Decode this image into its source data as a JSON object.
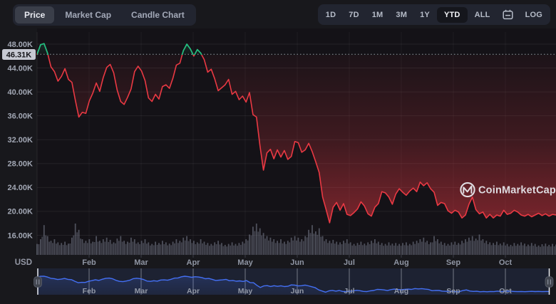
{
  "toolbar_left": {
    "tabs": [
      {
        "label": "Price",
        "selected": true
      },
      {
        "label": "Market Cap",
        "selected": false
      },
      {
        "label": "Candle Chart",
        "selected": false
      }
    ]
  },
  "toolbar_right": {
    "ranges": [
      "1D",
      "7D",
      "1M",
      "3M",
      "1Y",
      "YTD",
      "ALL"
    ],
    "selected_range": "YTD",
    "calendar_icon": "calendar-icon",
    "log_label": "LOG"
  },
  "axis": {
    "currency_label": "USD",
    "open_price_label": "46.31K",
    "y_ticks": [
      "48.00K",
      "44.00K",
      "40.00K",
      "36.00K",
      "32.00K",
      "28.00K",
      "24.00K",
      "20.00K",
      "16.00K"
    ]
  },
  "watermark": {
    "text": "CoinMarketCap",
    "logo": "coinmarketcap-logo"
  },
  "chart_data": {
    "type": "line",
    "title": "Bitcoin price, YTD, USD",
    "legend_position": "none",
    "grid": true,
    "x_months": [
      "Feb",
      "Mar",
      "Apr",
      "May",
      "Jun",
      "Jul",
      "Aug",
      "Sep",
      "Oct"
    ],
    "y_ticks_values": [
      48000,
      44000,
      40000,
      36000,
      32000,
      28000,
      24000,
      20000,
      16000
    ],
    "ylim": [
      16000,
      49500
    ],
    "open_price": 46310,
    "up_color": "#16c784",
    "down_color": "#ea3943",
    "navigator_color": "#4470f4",
    "volume_color": "#878da0",
    "prices_k": [
      46.3,
      47.9,
      48.1,
      46.5,
      44.2,
      43.4,
      41.8,
      42.6,
      43.9,
      42.1,
      41.6,
      38.6,
      35.8,
      36.6,
      36.4,
      38.5,
      39.8,
      41.5,
      40.1,
      42.4,
      44.1,
      44.6,
      43.2,
      40.3,
      38.4,
      37.9,
      39.1,
      40.5,
      43.4,
      44.3,
      43.5,
      41.9,
      39.0,
      38.4,
      39.6,
      38.8,
      40.9,
      41.2,
      40.6,
      42.3,
      44.5,
      44.8,
      46.9,
      48.0,
      47.2,
      46.0,
      47.1,
      46.5,
      45.4,
      43.3,
      43.8,
      42.2,
      40.2,
      40.7,
      41.2,
      42.1,
      39.6,
      40.1,
      38.7,
      39.3,
      38.3,
      39.9,
      36.2,
      35.8,
      31.0,
      26.9,
      29.8,
      30.4,
      28.8,
      30.3,
      29.1,
      30.2,
      28.7,
      29.2,
      31.7,
      31.5,
      29.9,
      30.3,
      31.4,
      30.0,
      28.3,
      26.5,
      22.4,
      20.3,
      18.1,
      20.7,
      21.5,
      20.2,
      21.3,
      19.5,
      19.3,
      19.8,
      20.4,
      21.6,
      20.9,
      19.6,
      19.2,
      20.7,
      21.3,
      23.3,
      23.1,
      22.4,
      21.2,
      22.9,
      23.8,
      23.2,
      22.7,
      23.4,
      23.9,
      23.3,
      24.9,
      24.3,
      24.8,
      23.8,
      23.2,
      21.0,
      21.5,
      21.3,
      20.1,
      19.7,
      20.2,
      19.9,
      18.9,
      19.4,
      21.2,
      22.4,
      20.3,
      19.6,
      19.9,
      18.9,
      19.5,
      18.9,
      19.4,
      19.2,
      20.2,
      19.5,
      19.7,
      20.2,
      19.9,
      19.4,
      19.2,
      19.5,
      19.1,
      19.4,
      19.7,
      19.3,
      19.6,
      19.2,
      19.5,
      19.4
    ],
    "volumes": [
      0.35,
      0.5,
      0.95,
      0.6,
      0.45,
      0.5,
      0.4,
      0.38,
      0.42,
      0.36,
      0.55,
      1.0,
      0.8,
      0.5,
      0.45,
      0.5,
      0.42,
      0.6,
      0.45,
      0.5,
      0.55,
      0.48,
      0.4,
      0.52,
      0.6,
      0.45,
      0.42,
      0.55,
      0.5,
      0.4,
      0.45,
      0.5,
      0.4,
      0.35,
      0.42,
      0.38,
      0.45,
      0.4,
      0.36,
      0.42,
      0.5,
      0.45,
      0.55,
      0.6,
      0.5,
      0.45,
      0.4,
      0.5,
      0.42,
      0.38,
      0.35,
      0.4,
      0.45,
      0.38,
      0.32,
      0.35,
      0.4,
      0.35,
      0.38,
      0.42,
      0.5,
      0.65,
      0.9,
      1.0,
      0.85,
      0.7,
      0.6,
      0.55,
      0.5,
      0.45,
      0.5,
      0.42,
      0.45,
      0.55,
      0.6,
      0.55,
      0.5,
      0.6,
      0.8,
      0.95,
      0.75,
      0.85,
      0.6,
      0.5,
      0.45,
      0.48,
      0.42,
      0.4,
      0.45,
      0.5,
      0.4,
      0.35,
      0.38,
      0.42,
      0.36,
      0.4,
      0.45,
      0.5,
      0.42,
      0.38,
      0.35,
      0.4,
      0.36,
      0.38,
      0.35,
      0.38,
      0.4,
      0.35,
      0.42,
      0.45,
      0.5,
      0.55,
      0.45,
      0.4,
      0.6,
      0.5,
      0.42,
      0.38,
      0.35,
      0.4,
      0.42,
      0.38,
      0.45,
      0.5,
      0.55,
      0.6,
      0.52,
      0.65,
      0.5,
      0.45,
      0.4,
      0.38,
      0.42,
      0.36,
      0.4,
      0.35,
      0.32,
      0.38,
      0.35,
      0.4,
      0.36,
      0.33,
      0.38,
      0.35,
      0.3,
      0.34,
      0.36,
      0.32,
      0.35,
      0.33
    ]
  }
}
